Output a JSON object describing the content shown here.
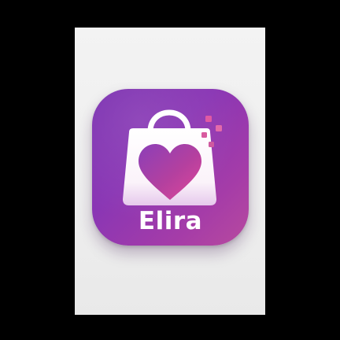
{
  "app": {
    "name": "Elira",
    "icon": "shopping-bag-heart-icon"
  },
  "colors": {
    "background": "#000000",
    "panel": "#eeeeee",
    "icon_gradient_start": "#7a2fb0",
    "icon_gradient_end": "#b84a9e",
    "heart_start": "#8b3fb8",
    "heart_end": "#e0479a",
    "text": "#ffffff"
  }
}
